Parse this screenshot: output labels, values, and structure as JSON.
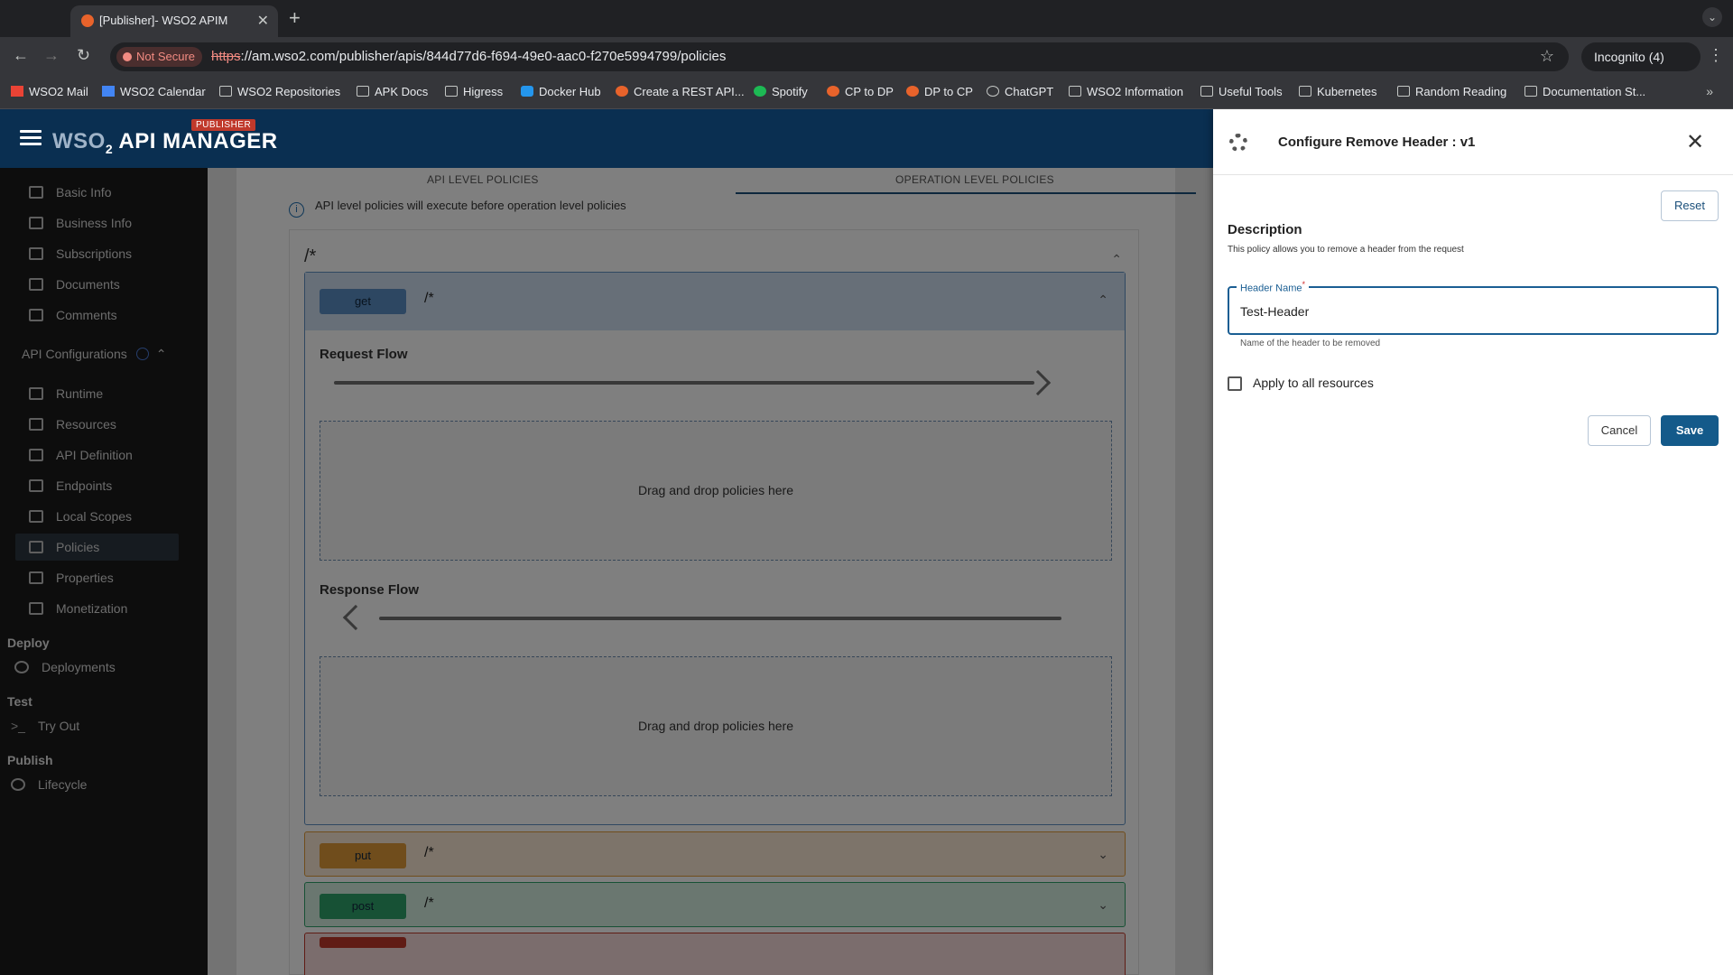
{
  "browser": {
    "tab_title": "[Publisher]- WSO2 APIM",
    "not_secure": "Not Secure",
    "url_proto": "https",
    "url_rest": "://am.wso2.com/publisher/apis/844d77d6-f694-49e0-aac0-f270e5994799/policies",
    "incognito": "Incognito (4)",
    "bookmarks": [
      {
        "label": "WSO2 Mail",
        "icon": "gmail-icon"
      },
      {
        "label": "WSO2 Calendar",
        "icon": "calendar-icon"
      },
      {
        "label": "WSO2 Repositories",
        "icon": "folder-icon"
      },
      {
        "label": "APK Docs",
        "icon": "folder-icon"
      },
      {
        "label": "Higress",
        "icon": "folder-icon"
      },
      {
        "label": "Docker Hub",
        "icon": "docker-icon"
      },
      {
        "label": "Create a REST API...",
        "icon": "site-icon"
      },
      {
        "label": "Spotify",
        "icon": "spotify-icon"
      },
      {
        "label": "CP to DP",
        "icon": "site-icon"
      },
      {
        "label": "DP to CP",
        "icon": "site-icon"
      },
      {
        "label": "ChatGPT",
        "icon": "chatgpt-icon"
      },
      {
        "label": "WSO2 Information",
        "icon": "folder-icon"
      },
      {
        "label": "Useful Tools",
        "icon": "folder-icon"
      },
      {
        "label": "Kubernetes",
        "icon": "folder-icon"
      },
      {
        "label": "Random Reading",
        "icon": "folder-icon"
      },
      {
        "label": "Documentation St...",
        "icon": "folder-icon"
      }
    ]
  },
  "app": {
    "logo_wso": "WSO",
    "logo_two": "2",
    "logo_name": "API MANAGER",
    "publisher_tag": "PUBLISHER"
  },
  "sidebar": {
    "items": [
      {
        "label": "Basic Info",
        "icon": "edit-icon"
      },
      {
        "label": "Business Info",
        "icon": "business-icon"
      },
      {
        "label": "Subscriptions",
        "icon": "rss-icon"
      },
      {
        "label": "Documents",
        "icon": "documents-icon"
      },
      {
        "label": "Comments",
        "icon": "comment-icon"
      }
    ],
    "api_config": "API Configurations",
    "config_items": [
      {
        "label": "Runtime",
        "icon": "gear-icon"
      },
      {
        "label": "Resources",
        "icon": "resources-icon"
      },
      {
        "label": "API Definition",
        "icon": "code-icon"
      },
      {
        "label": "Endpoints",
        "icon": "endpoints-icon"
      },
      {
        "label": "Local Scopes",
        "icon": "key-icon"
      },
      {
        "label": "Policies",
        "icon": "swap-icon"
      },
      {
        "label": "Properties",
        "icon": "list-icon"
      },
      {
        "label": "Monetization",
        "icon": "dollar-icon"
      }
    ],
    "deploy": "Deploy",
    "deployments": "Deployments",
    "test": "Test",
    "try_out": "Try Out",
    "publish": "Publish",
    "lifecycle": "Lifecycle"
  },
  "policies": {
    "tab_api": "API LEVEL POLICIES",
    "tab_operation": "OPERATION LEVEL POLICIES",
    "info": "API level policies will execute before operation level policies",
    "route": "/*",
    "operations": [
      {
        "verb": "get",
        "path": "/*"
      },
      {
        "verb": "put",
        "path": "/*"
      },
      {
        "verb": "post",
        "path": "/*"
      }
    ],
    "request_flow": "Request Flow",
    "response_flow": "Response Flow",
    "drop_text": "Drag and drop policies here"
  },
  "drawer": {
    "title": "Configure Remove Header : v1",
    "reset": "Reset",
    "description_title": "Description",
    "description": "This policy allows you to remove a header from the request",
    "field_label": "Header Name",
    "field_required": "*",
    "field_value": "Test-Header",
    "helper": "Name of the header to be removed",
    "apply_all": "Apply to all resources",
    "cancel": "Cancel",
    "save": "Save"
  }
}
